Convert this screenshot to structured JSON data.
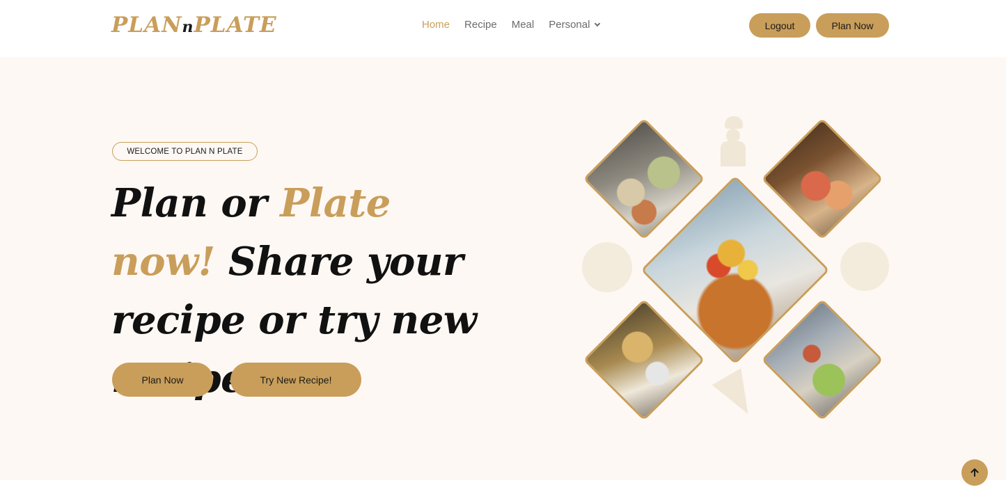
{
  "brand": {
    "logo_left": "PLAN",
    "logo_mid": "n",
    "logo_right": "PLATE"
  },
  "nav": {
    "items": [
      {
        "label": "Home",
        "active": true
      },
      {
        "label": "Recipe",
        "active": false
      },
      {
        "label": "Meal",
        "active": false
      },
      {
        "label": "Personal",
        "active": false,
        "dropdown": true
      }
    ]
  },
  "header_buttons": {
    "logout": "Logout",
    "plan_now": "Plan Now"
  },
  "hero": {
    "badge": "WELCOME TO PLAN N PLATE",
    "headline": {
      "part1": "Plan or ",
      "part2_gold": "Plate",
      "part3_gold": "now!",
      "part4": "Share your recipe or try new recipe!"
    },
    "cta_primary": "Plan Now",
    "cta_secondary": "Try New Recipe!"
  },
  "colors": {
    "accent": "#c99e5a",
    "hero_bg": "#fdf8f4",
    "text_dark": "#111111",
    "nav_text": "#6b6b6b"
  },
  "icons": {
    "back_to_top": "arrow-up-icon",
    "dropdown": "chevron-down-icon"
  }
}
